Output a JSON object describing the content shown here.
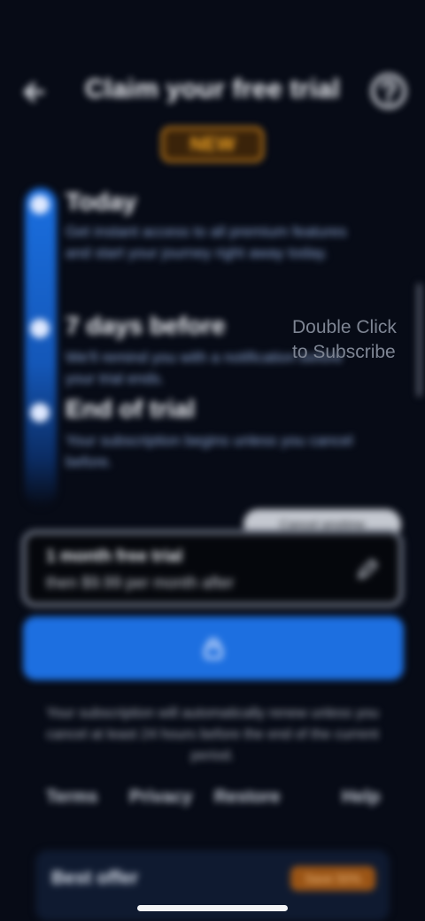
{
  "header": {
    "title": "Claim your free trial"
  },
  "badge": {
    "label": "NEW"
  },
  "steps": [
    {
      "title": "Today",
      "description": "Get instant access to all premium features and start your journey right away today."
    },
    {
      "title": "7 days before",
      "description": "We'll remind you with a notification before your trial ends."
    },
    {
      "title": "End of trial",
      "description": "Your subscription begins unless you cancel before."
    }
  ],
  "watermark": {
    "line1": "Double Click",
    "line2": "to Subscribe"
  },
  "tooltip": {
    "text": "Cancel anytime"
  },
  "plan_input": {
    "line1": "1 month free trial",
    "line2": "then $9.99 per month after"
  },
  "cta": {
    "icon": "lock-icon"
  },
  "legal_text": "Your subscription will automatically renew unless you cancel at least 24 hours before the end of the current period.",
  "footer_links": [
    "Terms",
    "Privacy",
    "Restore",
    "Help"
  ],
  "promo": {
    "label": "Best offer",
    "tag": "Save 50%"
  },
  "colors": {
    "accent": "#1d6fe0",
    "badge": "#d98a1a",
    "background": "#070b16"
  }
}
